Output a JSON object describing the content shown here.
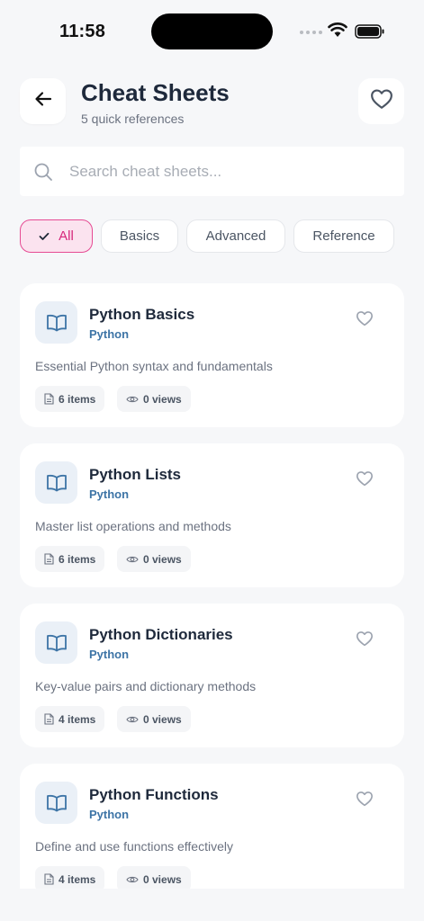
{
  "status_bar": {
    "time": "11:58"
  },
  "header": {
    "title": "Cheat Sheets",
    "subtitle": "5 quick references",
    "back_icon": "arrow-left-icon",
    "favorite_icon": "heart-icon"
  },
  "search": {
    "placeholder": "Search cheat sheets...",
    "value": ""
  },
  "filters": [
    {
      "label": "All",
      "active": true
    },
    {
      "label": "Basics",
      "active": false
    },
    {
      "label": "Advanced",
      "active": false
    },
    {
      "label": "Reference",
      "active": false
    }
  ],
  "cards": [
    {
      "title": "Python Basics",
      "tag": "Python",
      "description": "Essential Python syntax and fundamentals",
      "items": "6 items",
      "views": "0 views"
    },
    {
      "title": "Python Lists",
      "tag": "Python",
      "description": "Master list operations and methods",
      "items": "6 items",
      "views": "0 views"
    },
    {
      "title": "Python Dictionaries",
      "tag": "Python",
      "description": "Key-value pairs and dictionary methods",
      "items": "4 items",
      "views": "0 views"
    },
    {
      "title": "Python Functions",
      "tag": "Python",
      "description": "Define and use functions effectively",
      "items": "4 items",
      "views": "0 views"
    }
  ],
  "colors": {
    "accent": "#e64b93",
    "accent_bg": "#fbe3ef",
    "tag": "#3d74a6",
    "background": "#f6f7f9"
  }
}
